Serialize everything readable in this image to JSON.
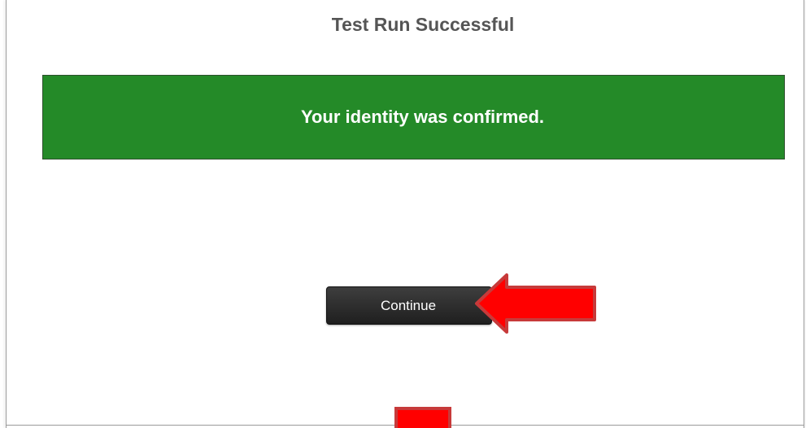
{
  "page": {
    "title": "Test Run Successful"
  },
  "banner": {
    "message": "Your identity was confirmed.",
    "color": "#248a28"
  },
  "actions": {
    "continue_label": "Continue"
  },
  "annotations": {
    "arrow_color": "#ff0000",
    "arrow_icon_continue": "red-arrow-left-icon",
    "arrow_icon_bottom": "red-arrow-down-icon"
  }
}
